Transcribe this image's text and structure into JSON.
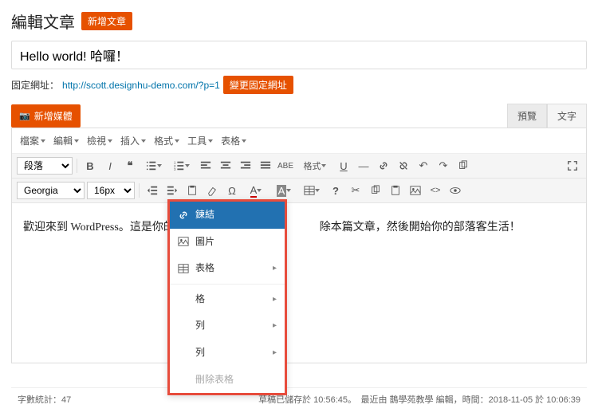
{
  "header": {
    "title": "編輯文章",
    "add_new_label": "新增文章"
  },
  "post": {
    "title": "Hello world! 哈囉！"
  },
  "permalink": {
    "label": "固定網址：",
    "url": "http://scott.designhu-demo.com/?p=1",
    "change_button": "變更固定網址"
  },
  "media": {
    "add_button": "新增媒體"
  },
  "tabs": {
    "visual": "預覽",
    "text": "文字"
  },
  "menubar": [
    "檔案",
    "編輯",
    "檢視",
    "插入",
    "格式",
    "工具",
    "表格"
  ],
  "toolbar1": {
    "block_format": "段落",
    "style_label": "格式"
  },
  "toolbar2": {
    "font_family": "Georgia",
    "font_size": "16px"
  },
  "content": {
    "body_text": "歡迎來到 WordPress。這是你的　　　　　　　　　　　　　除本篇文章，然後開始你的部落客生活！"
  },
  "context_menu": {
    "items": [
      {
        "label": "鍊結",
        "icon": "link",
        "highlighted": true
      },
      {
        "label": "圖片",
        "icon": "image"
      },
      {
        "label": "表格",
        "icon": "table",
        "submenu": true
      }
    ],
    "sub_items": [
      {
        "label": "格",
        "submenu": true
      },
      {
        "label": "列",
        "submenu": true
      },
      {
        "label": "列",
        "submenu": true
      },
      {
        "label": "刪除表格",
        "disabled": true
      }
    ]
  },
  "footer": {
    "word_count_label": "字數統計：",
    "word_count": "47",
    "status": "草稿已儲存於 10:56:45。　最近由 鵲學苑教學 編輯，時間：2018-11-05 於 10:06:39"
  }
}
